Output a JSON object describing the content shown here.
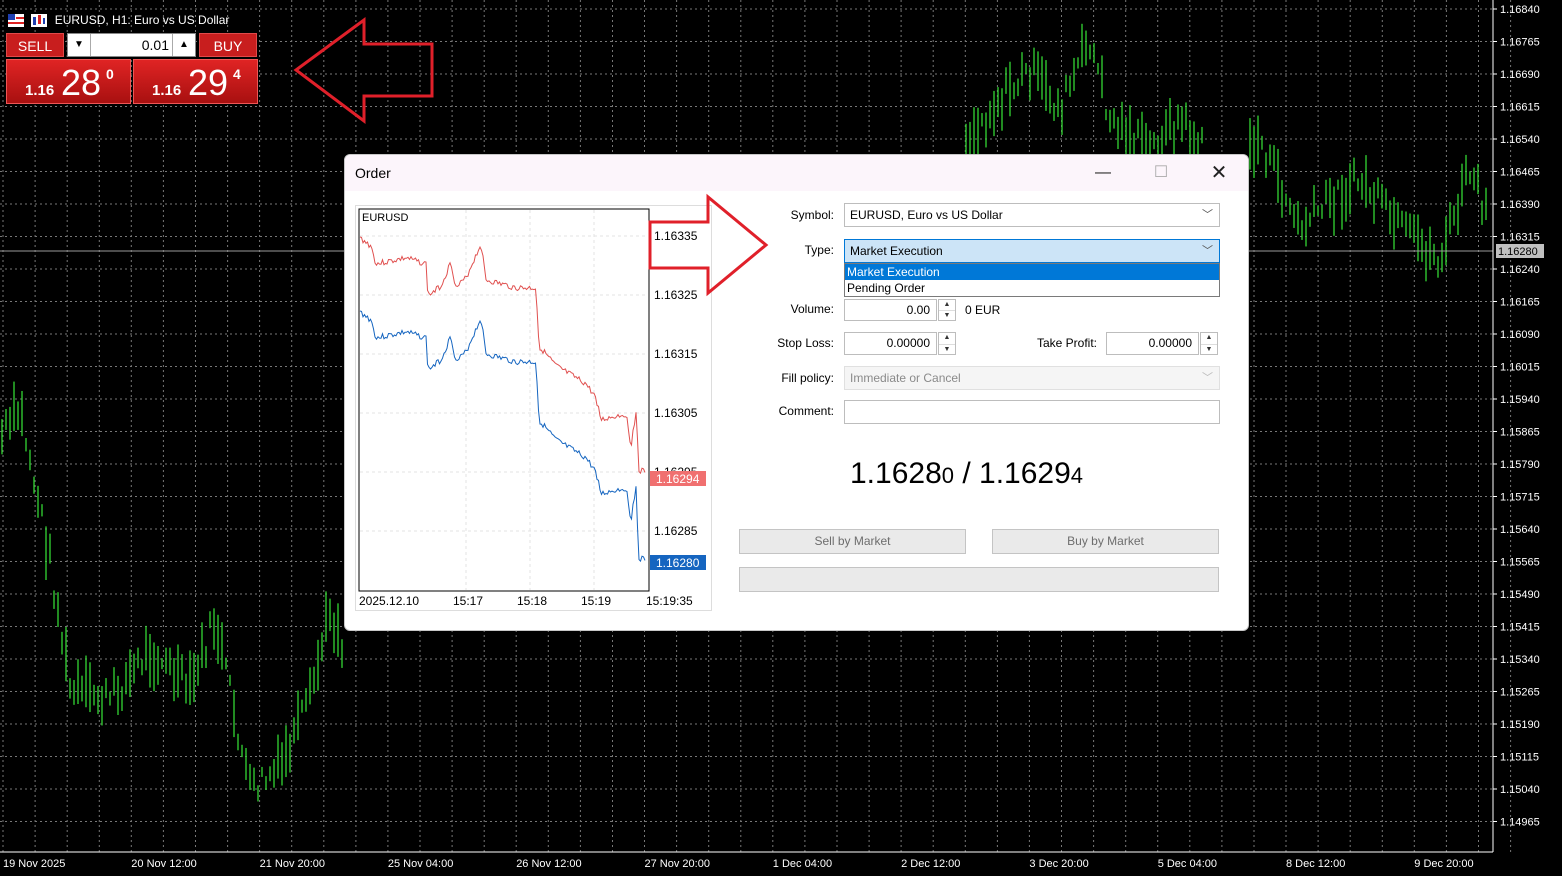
{
  "main_chart": {
    "title": "EURUSD, H1:  Euro vs US Dollar",
    "current_price_label": "1.16280",
    "price_ticks": [
      "1.16840",
      "1.16765",
      "1.16690",
      "1.16615",
      "1.16540",
      "1.16465",
      "1.16390",
      "1.16315",
      "1.16240",
      "1.16165",
      "1.16090",
      "1.16015",
      "1.15940",
      "1.15865",
      "1.15790",
      "1.15715",
      "1.15640",
      "1.15565",
      "1.15490",
      "1.15415",
      "1.15340",
      "1.15265",
      "1.15190",
      "1.15115",
      "1.15040",
      "1.14965"
    ],
    "time_ticks": [
      "19 Nov 2025",
      "20 Nov 12:00",
      "21 Nov 20:00",
      "25 Nov 04:00",
      "26 Nov 12:00",
      "27 Nov 20:00",
      "1 Dec 04:00",
      "2 Dec 12:00",
      "3 Dec 20:00",
      "5 Dec 04:00",
      "8 Dec 12:00",
      "9 Dec 20:00"
    ],
    "colors": {
      "background": "#000000",
      "grid": "#7a7a7a",
      "bars": "#33d633",
      "axis_text": "#ffffff",
      "current_price_box": "#c0c0c0"
    }
  },
  "one_click": {
    "sell_label": "SELL",
    "buy_label": "BUY",
    "volume": "0.01",
    "sell_price_small": "1.16",
    "sell_price_big": "28",
    "sell_price_sup": "0",
    "buy_price_small": "1.16",
    "buy_price_big": "29",
    "buy_price_sup": "4",
    "color": "#c81e1e"
  },
  "order_dialog": {
    "title": "Order",
    "mini_chart": {
      "symbol_label": "EURUSD",
      "price_ticks": [
        "1.16335",
        "1.16325",
        "1.16315",
        "1.16305",
        "1.16295",
        "1.16285"
      ],
      "ask_label": "1.16294",
      "bid_label": "1.16280",
      "time_ticks": [
        "2025.12.10",
        "15:17",
        "15:18",
        "15:19",
        "15:19:35"
      ],
      "ask_color": "#e0504f",
      "bid_color": "#1565c0"
    },
    "symbol_label": "Symbol:",
    "symbol_value": "EURUSD, Euro vs US Dollar",
    "type_label": "Type:",
    "type_value": "Market Execution",
    "type_options": [
      "Market Execution",
      "Pending Order"
    ],
    "volume_label": "Volume:",
    "volume_value": "0.00",
    "volume_unit": "0 EUR",
    "stop_loss_label": "Stop Loss:",
    "stop_loss_value": "0.00000",
    "take_profit_label": "Take Profit:",
    "take_profit_value": "0.00000",
    "fill_policy_label": "Fill policy:",
    "fill_policy_value": "Immediate or Cancel",
    "comment_label": "Comment:",
    "comment_value": "",
    "bid_main": "1.1628",
    "bid_small": "0",
    "separator": " / ",
    "ask_main": "1.1629",
    "ask_small": "4",
    "sell_button": "Sell by Market",
    "buy_button": "Buy by Market"
  },
  "annotations": {
    "arrow_color": "#e0202a"
  }
}
